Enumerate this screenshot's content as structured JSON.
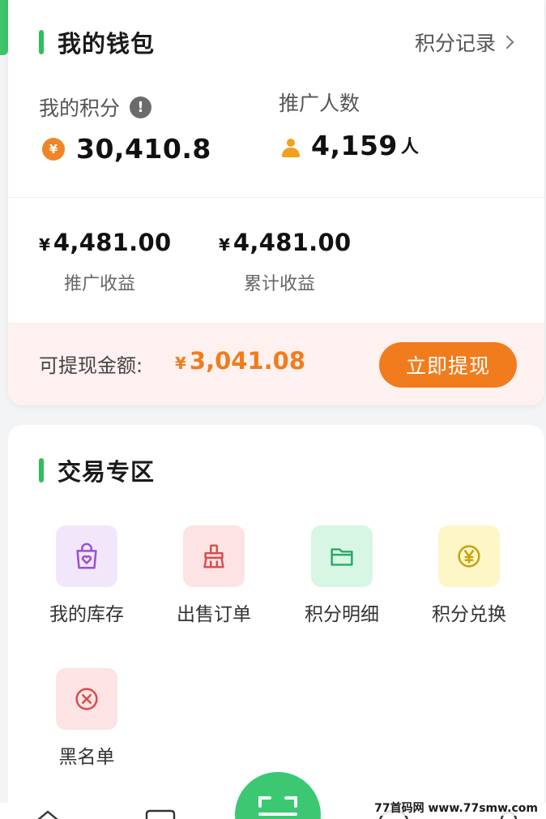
{
  "wallet": {
    "title": "我的钱包",
    "records_link": "积分记录",
    "points_label": "我的积分",
    "points_value": "30,410.8",
    "promo_label": "推广人数",
    "promo_value": "4,159",
    "promo_unit": "人",
    "earnings": [
      {
        "currency": "¥",
        "value": "4,481.00",
        "label": "推广收益"
      },
      {
        "currency": "¥",
        "value": "4,481.00",
        "label": "累计收益"
      }
    ],
    "withdraw": {
      "label": "可提现金额:",
      "currency": "¥",
      "value": "3,041.08",
      "button": "立即提现"
    }
  },
  "trade": {
    "title": "交易专区",
    "items": [
      {
        "label": "我的库存",
        "icon": "shopping-bag-heart-icon"
      },
      {
        "label": "出售订单",
        "icon": "broom-icon"
      },
      {
        "label": "积分明细",
        "icon": "folder-icon"
      },
      {
        "label": "积分兑换",
        "icon": "yen-coin-icon"
      },
      {
        "label": "黑名单",
        "icon": "circle-x-icon"
      }
    ]
  },
  "watermark": "77首码网 www.77smw.com",
  "colors": {
    "accent_green": "#2fbf5a",
    "accent_orange": "#f17c1e",
    "withdraw_bg": "#fff1ef"
  }
}
